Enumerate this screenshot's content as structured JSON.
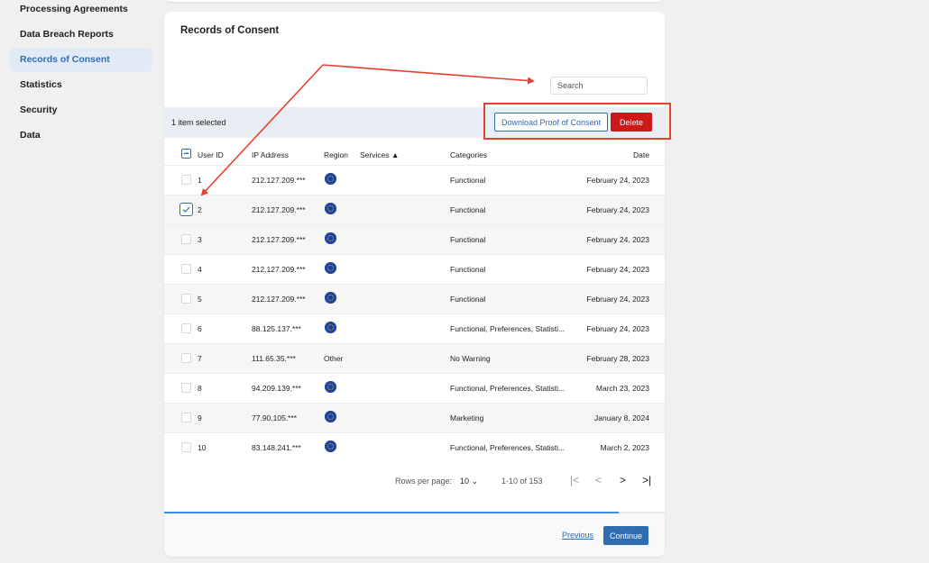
{
  "sidebar": {
    "items": [
      {
        "label": "Processing Agreements"
      },
      {
        "label": "Data Breach Reports"
      },
      {
        "label": "Records of Consent"
      },
      {
        "label": "Statistics"
      },
      {
        "label": "Security"
      },
      {
        "label": "Data"
      }
    ],
    "active_index": 2
  },
  "card": {
    "title": "Records of Consent",
    "search_placeholder": "Search",
    "selected_text": "1 item selected",
    "download_label": "Download Proof of Consent",
    "delete_label": "Delete"
  },
  "table": {
    "headers": {
      "user_id": "User ID",
      "ip": "IP Address",
      "region": "Region",
      "services": "Services ▲",
      "categories": "Categories",
      "date": "Date"
    },
    "rows": [
      {
        "id": "1",
        "ip": "212.127.209.***",
        "region": "eu-flag",
        "categories": "Functional",
        "date": "February 24, 2023",
        "checked": false
      },
      {
        "id": "2",
        "ip": "212.127.209.***",
        "region": "eu-flag",
        "categories": "Functional",
        "date": "February 24, 2023",
        "checked": true
      },
      {
        "id": "3",
        "ip": "212.127.209.***",
        "region": "eu-flag",
        "categories": "Functional",
        "date": "February 24, 2023",
        "checked": false
      },
      {
        "id": "4",
        "ip": "212.127.209.***",
        "region": "eu-flag",
        "categories": "Functional",
        "date": "February 24, 2023",
        "checked": false
      },
      {
        "id": "5",
        "ip": "212.127.209.***",
        "region": "eu-flag",
        "categories": "Functional",
        "date": "February 24, 2023",
        "checked": false
      },
      {
        "id": "6",
        "ip": "88.125.137.***",
        "region": "eu-flag",
        "categories": "Functional, Preferences, Statisti...",
        "date": "February 24, 2023",
        "checked": false
      },
      {
        "id": "7",
        "ip": "111.65.35.***",
        "region": "Other",
        "categories": "No Warning",
        "date": "February 28, 2023",
        "checked": false
      },
      {
        "id": "8",
        "ip": "94.209.139.***",
        "region": "eu-flag",
        "categories": "Functional, Preferences, Statisti...",
        "date": "March 23, 2023",
        "checked": false
      },
      {
        "id": "9",
        "ip": "77.90.105.***",
        "region": "eu-flag",
        "categories": "Marketing",
        "date": "January 8, 2024",
        "checked": false
      },
      {
        "id": "10",
        "ip": "83.148.241.***",
        "region": "eu-flag",
        "categories": "Functional, Preferences, Statisti...",
        "date": "March 2, 2023",
        "checked": false
      }
    ]
  },
  "pagination": {
    "rows_per_page_label": "Rows per page:",
    "rows_per_page": "10",
    "range": "1-10 of 153"
  },
  "progress": {
    "fraction": 0.908
  },
  "footer": {
    "previous_label": "Previous",
    "continue_label": "Continue"
  },
  "colors": {
    "accent": "#2f6db1",
    "danger": "#cc1818",
    "annotation": "#e8402e"
  }
}
